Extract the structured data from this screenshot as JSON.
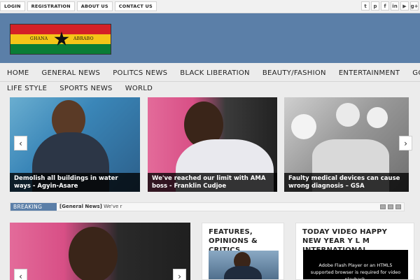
{
  "topbar": {
    "links": [
      "LOGIN",
      "REGISTRATION",
      "ABOUT US",
      "CONTACT US"
    ],
    "social": [
      {
        "icon": "twitter-icon",
        "glyph": "t"
      },
      {
        "icon": "pinterest-icon",
        "glyph": "p"
      },
      {
        "icon": "facebook-icon",
        "glyph": "f"
      },
      {
        "icon": "linkedin-icon",
        "glyph": "in"
      },
      {
        "icon": "youtube-icon",
        "glyph": "▶"
      },
      {
        "icon": "google-plus-icon",
        "glyph": "g+"
      }
    ]
  },
  "header": {
    "logo_left": "GHANA",
    "logo_right": "ABRABO",
    "background": "#5b7fa8"
  },
  "nav": {
    "row1": [
      "HOME",
      "GENERAL NEWS",
      "POLITCS NEWS",
      "BLACK LIBERATION",
      "BEAUTY/FASHION",
      "ENTERTAINMENT",
      "GOSSIP"
    ],
    "row2": [
      "LIFE STYLE",
      "SPORTS NEWS",
      "WORLD"
    ]
  },
  "slider": {
    "slides": [
      {
        "caption": "Demolish all buildings in water ways - Agyin-Asare"
      },
      {
        "caption": "We've reached our limit with AMA boss - Franklin Cudjoe"
      },
      {
        "caption": "Faulty medical devices can cause wrong diagnosis – GSA"
      }
    ],
    "prev_glyph": "‹",
    "next_glyph": "›"
  },
  "breaking": {
    "label": "BREAKING",
    "category": "[General News]",
    "text": "We've r"
  },
  "widgets": {
    "features_title": "FEATURES, OPINIONS & CRITICS",
    "video_title": "TODAY VIDEO HAPPY NEW YEAR Y L M INTERNATIONAL",
    "video_message": "Adobe Flash Player or an HTML5 supported browser is required for video playback."
  },
  "colors": {
    "accent": "#5b7fa8",
    "caption_bg": "#000000",
    "flag_red": "#d42127",
    "flag_gold": "#f5c518",
    "flag_green": "#0a7d36"
  }
}
